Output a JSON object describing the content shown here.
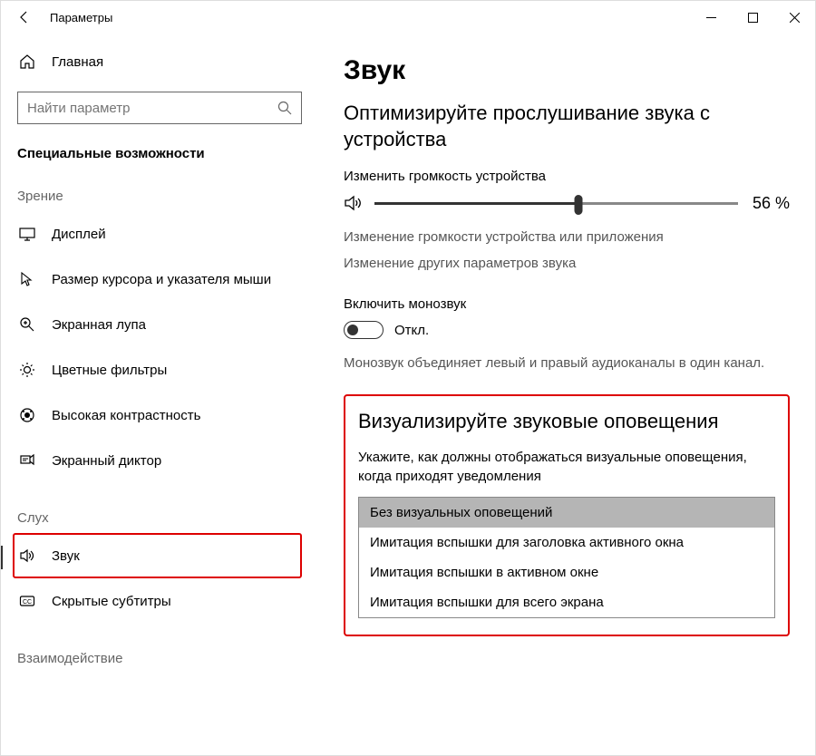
{
  "titlebar": {
    "title": "Параметры"
  },
  "sidebar": {
    "home": "Главная",
    "search_placeholder": "Найти параметр",
    "category": "Специальные возможности",
    "sections": {
      "vision": {
        "header": "Зрение",
        "items": [
          {
            "label": "Дисплей"
          },
          {
            "label": "Размер курсора и указателя мыши"
          },
          {
            "label": "Экранная лупа"
          },
          {
            "label": "Цветные фильтры"
          },
          {
            "label": "Высокая контрастность"
          },
          {
            "label": "Экранный диктор"
          }
        ]
      },
      "hearing": {
        "header": "Слух",
        "items": [
          {
            "label": "Звук"
          },
          {
            "label": "Скрытые субтитры"
          }
        ]
      },
      "interaction": {
        "header": "Взаимодействие"
      }
    }
  },
  "main": {
    "title": "Звук",
    "optimize_heading": "Оптимизируйте прослушивание звука с устройства",
    "volume_label": "Изменить громкость устройства",
    "volume_value": "56",
    "volume_display": "56 %",
    "link_app_volume": "Изменение громкости устройства или приложения",
    "link_other_sound": "Изменение других параметров звука",
    "mono_label": "Включить монозвук",
    "toggle_state": "Откл.",
    "mono_desc": "Монозвук объединяет левый и правый аудиоканалы в один канал.",
    "visual_heading": "Визуализируйте звуковые оповещения",
    "visual_desc": "Укажите, как должны отображаться визуальные оповещения, когда приходят уведомления",
    "visual_options": [
      "Без визуальных оповещений",
      "Имитация вспышки для заголовка активного окна",
      "Имитация вспышки в активном окне",
      "Имитация вспышки для всего экрана"
    ]
  }
}
